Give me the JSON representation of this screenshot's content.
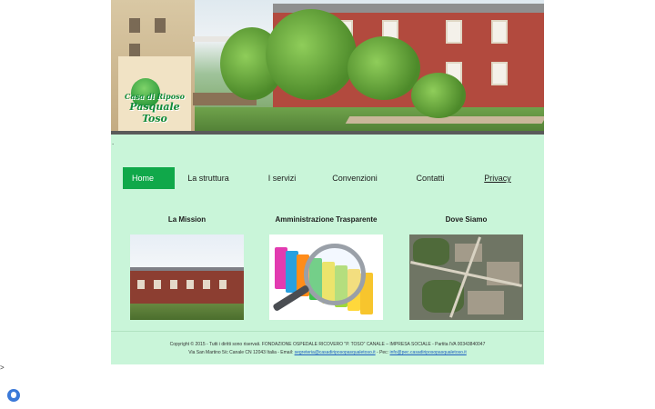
{
  "logo": {
    "line1": "Casa di Riposo",
    "line2": "Pasquale Toso"
  },
  "stray_dot": ".",
  "stray_gt": ">",
  "nav": {
    "items": [
      {
        "label": "Home"
      },
      {
        "label": "La struttura"
      },
      {
        "label": "I servizi"
      },
      {
        "label": "Convenzioni"
      },
      {
        "label": "Contatti"
      },
      {
        "label": "Privacy"
      }
    ],
    "active_color": "#10a84a"
  },
  "sections": [
    {
      "title": "La Mission"
    },
    {
      "title": "Amministrazione Trasparente"
    },
    {
      "title": "Dove Siamo"
    }
  ],
  "footer": {
    "line1": "Copyright © 2015 - Tutti i diritti sono riservati. FONDAZIONE OSPEDALE RICOVERO \"P. TOSO\" CANALE – IMPRESA SOCIALE - Partita IVA 00343840047",
    "line2_prefix": "Via San Martino 5/c Canale CN 12043 Italia - Email:",
    "email": "segreteria@casadiriposopasqualetoso.it",
    "pec_prefix": "- Pec:",
    "pec": "info@pec.casadiriposopasqualetoso.it"
  },
  "colors": {
    "page_bg": "#c9f5d9",
    "accent": "#10a84a",
    "link": "#1a5dc0"
  },
  "icons": {
    "widget": "accessibility-shield-icon"
  }
}
